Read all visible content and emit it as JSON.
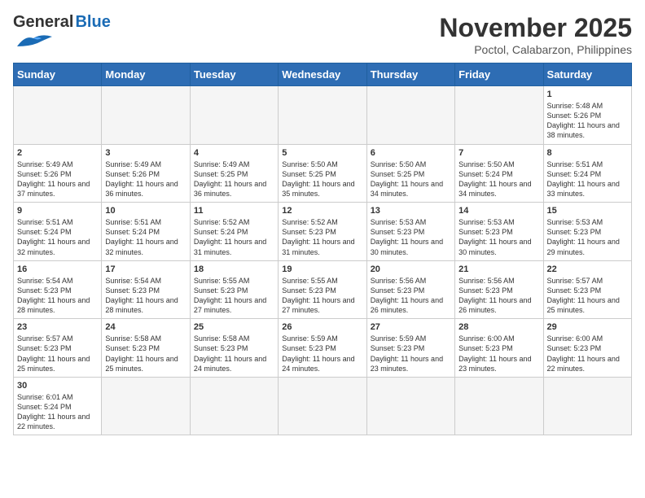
{
  "header": {
    "logo_general": "General",
    "logo_blue": "Blue",
    "month_title": "November 2025",
    "location": "Poctol, Calabarzon, Philippines"
  },
  "weekdays": [
    "Sunday",
    "Monday",
    "Tuesday",
    "Wednesday",
    "Thursday",
    "Friday",
    "Saturday"
  ],
  "weeks": [
    [
      {
        "day": "",
        "empty": true
      },
      {
        "day": "",
        "empty": true
      },
      {
        "day": "",
        "empty": true
      },
      {
        "day": "",
        "empty": true
      },
      {
        "day": "",
        "empty": true
      },
      {
        "day": "",
        "empty": true
      },
      {
        "day": "1",
        "sunrise": "5:48 AM",
        "sunset": "5:26 PM",
        "daylight": "11 hours and 38 minutes."
      }
    ],
    [
      {
        "day": "2",
        "sunrise": "5:49 AM",
        "sunset": "5:26 PM",
        "daylight": "11 hours and 37 minutes."
      },
      {
        "day": "3",
        "sunrise": "5:49 AM",
        "sunset": "5:26 PM",
        "daylight": "11 hours and 36 minutes."
      },
      {
        "day": "4",
        "sunrise": "5:49 AM",
        "sunset": "5:25 PM",
        "daylight": "11 hours and 36 minutes."
      },
      {
        "day": "5",
        "sunrise": "5:50 AM",
        "sunset": "5:25 PM",
        "daylight": "11 hours and 35 minutes."
      },
      {
        "day": "6",
        "sunrise": "5:50 AM",
        "sunset": "5:25 PM",
        "daylight": "11 hours and 34 minutes."
      },
      {
        "day": "7",
        "sunrise": "5:50 AM",
        "sunset": "5:24 PM",
        "daylight": "11 hours and 34 minutes."
      },
      {
        "day": "8",
        "sunrise": "5:51 AM",
        "sunset": "5:24 PM",
        "daylight": "11 hours and 33 minutes."
      }
    ],
    [
      {
        "day": "9",
        "sunrise": "5:51 AM",
        "sunset": "5:24 PM",
        "daylight": "11 hours and 32 minutes."
      },
      {
        "day": "10",
        "sunrise": "5:51 AM",
        "sunset": "5:24 PM",
        "daylight": "11 hours and 32 minutes."
      },
      {
        "day": "11",
        "sunrise": "5:52 AM",
        "sunset": "5:24 PM",
        "daylight": "11 hours and 31 minutes."
      },
      {
        "day": "12",
        "sunrise": "5:52 AM",
        "sunset": "5:23 PM",
        "daylight": "11 hours and 31 minutes."
      },
      {
        "day": "13",
        "sunrise": "5:53 AM",
        "sunset": "5:23 PM",
        "daylight": "11 hours and 30 minutes."
      },
      {
        "day": "14",
        "sunrise": "5:53 AM",
        "sunset": "5:23 PM",
        "daylight": "11 hours and 30 minutes."
      },
      {
        "day": "15",
        "sunrise": "5:53 AM",
        "sunset": "5:23 PM",
        "daylight": "11 hours and 29 minutes."
      }
    ],
    [
      {
        "day": "16",
        "sunrise": "5:54 AM",
        "sunset": "5:23 PM",
        "daylight": "11 hours and 28 minutes."
      },
      {
        "day": "17",
        "sunrise": "5:54 AM",
        "sunset": "5:23 PM",
        "daylight": "11 hours and 28 minutes."
      },
      {
        "day": "18",
        "sunrise": "5:55 AM",
        "sunset": "5:23 PM",
        "daylight": "11 hours and 27 minutes."
      },
      {
        "day": "19",
        "sunrise": "5:55 AM",
        "sunset": "5:23 PM",
        "daylight": "11 hours and 27 minutes."
      },
      {
        "day": "20",
        "sunrise": "5:56 AM",
        "sunset": "5:23 PM",
        "daylight": "11 hours and 26 minutes."
      },
      {
        "day": "21",
        "sunrise": "5:56 AM",
        "sunset": "5:23 PM",
        "daylight": "11 hours and 26 minutes."
      },
      {
        "day": "22",
        "sunrise": "5:57 AM",
        "sunset": "5:23 PM",
        "daylight": "11 hours and 25 minutes."
      }
    ],
    [
      {
        "day": "23",
        "sunrise": "5:57 AM",
        "sunset": "5:23 PM",
        "daylight": "11 hours and 25 minutes."
      },
      {
        "day": "24",
        "sunrise": "5:58 AM",
        "sunset": "5:23 PM",
        "daylight": "11 hours and 25 minutes."
      },
      {
        "day": "25",
        "sunrise": "5:58 AM",
        "sunset": "5:23 PM",
        "daylight": "11 hours and 24 minutes."
      },
      {
        "day": "26",
        "sunrise": "5:59 AM",
        "sunset": "5:23 PM",
        "daylight": "11 hours and 24 minutes."
      },
      {
        "day": "27",
        "sunrise": "5:59 AM",
        "sunset": "5:23 PM",
        "daylight": "11 hours and 23 minutes."
      },
      {
        "day": "28",
        "sunrise": "6:00 AM",
        "sunset": "5:23 PM",
        "daylight": "11 hours and 23 minutes."
      },
      {
        "day": "29",
        "sunrise": "6:00 AM",
        "sunset": "5:23 PM",
        "daylight": "11 hours and 22 minutes."
      }
    ],
    [
      {
        "day": "30",
        "sunrise": "6:01 AM",
        "sunset": "5:24 PM",
        "daylight": "11 hours and 22 minutes."
      },
      {
        "day": "",
        "empty": true
      },
      {
        "day": "",
        "empty": true
      },
      {
        "day": "",
        "empty": true
      },
      {
        "day": "",
        "empty": true
      },
      {
        "day": "",
        "empty": true
      },
      {
        "day": "",
        "empty": true
      }
    ]
  ]
}
